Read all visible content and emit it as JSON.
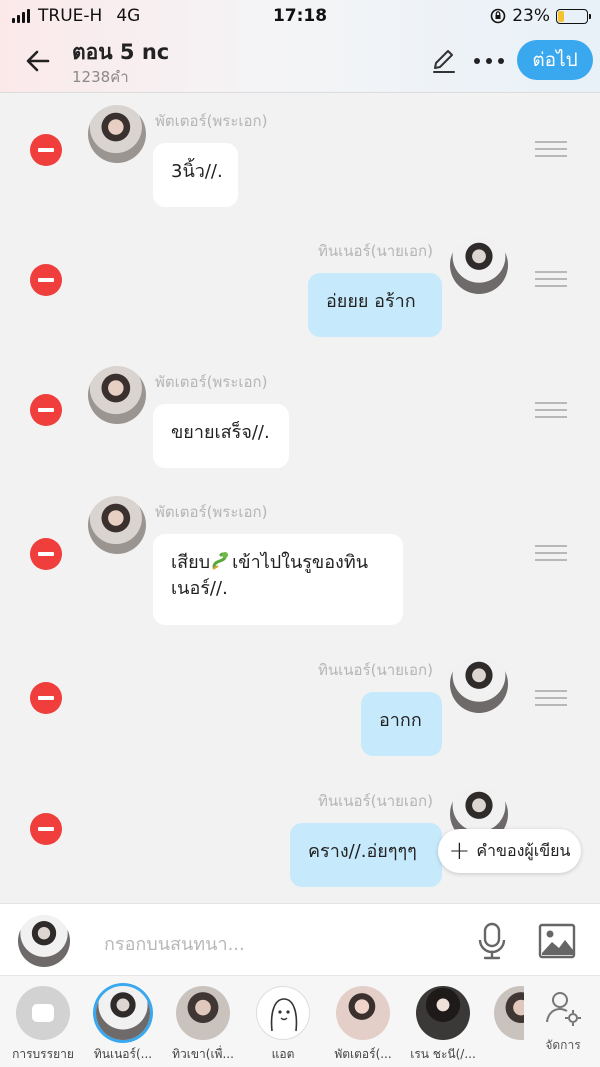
{
  "status": {
    "carrier": "TRUE-H",
    "network": "4G",
    "time": "17:18",
    "battery": "23%",
    "battery_level": 0.23
  },
  "header": {
    "title": "ตอน 5 nc",
    "subtitle": "1238คำ",
    "next_label": "ต่อไป"
  },
  "messages": [
    {
      "side": "left",
      "name": "พัตเตอร์(พระเอก)",
      "text": "3นิ้ว//."
    },
    {
      "side": "right",
      "name": "ทินเนอร์(นายเอก)",
      "text": "อ่ยยย อร้าก"
    },
    {
      "side": "left",
      "name": "พัตเตอร์(พระเอก)",
      "text": "ขยายเสร็จ//."
    },
    {
      "side": "left",
      "name": "พัตเตอร์(พระเอก)",
      "text_part1": "เสียบ",
      "text_part2": "เข้าไปในรูของทิน",
      "text_line2": "เนอร์//."
    },
    {
      "side": "right",
      "name": "ทินเนอร์(นายเอก)",
      "text": "อากก"
    },
    {
      "side": "right",
      "name": "ทินเนอร์(นายเอก)",
      "text": "คราง//.อ่ยๆๆๆ"
    }
  ],
  "comment_chip": "คำของผู้เขียน",
  "input": {
    "placeholder": "กรอกบนสนทนา..."
  },
  "characters": [
    {
      "label": "การบรรยาย"
    },
    {
      "label": "ทินเนอร์(..."
    },
    {
      "label": "ทิวเขา(เพื่..."
    },
    {
      "label": "แอต"
    },
    {
      "label": "พัตเตอร์(..."
    },
    {
      "label": "เรน ชะนี(/..."
    }
  ],
  "manage_label": "จัดการ",
  "colors": {
    "accent": "#3aa8ee",
    "remove": "#ef3e3b",
    "bubble_right": "#c6eafb"
  }
}
